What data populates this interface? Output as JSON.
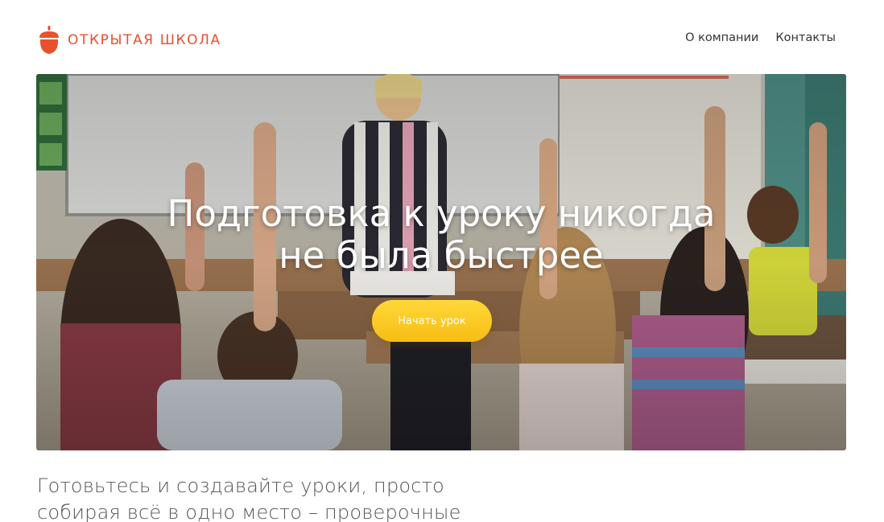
{
  "brand": {
    "name": "ОТКРЫТАЯ ШКОЛА",
    "color": "#e8512f"
  },
  "nav": {
    "items": [
      {
        "label": "О компании"
      },
      {
        "label": "Контакты"
      }
    ]
  },
  "hero": {
    "title_line1": "Подготовка к уроку никогда",
    "title_line2": "не была быстрее",
    "cta_label": "Начать урок",
    "cta_color": "#f9c623",
    "image": "classroom-photo"
  },
  "intro": {
    "line1": "Готовьтесь и создавайте уроки, просто",
    "line2": "собирая всё в одно место – проверочные"
  }
}
